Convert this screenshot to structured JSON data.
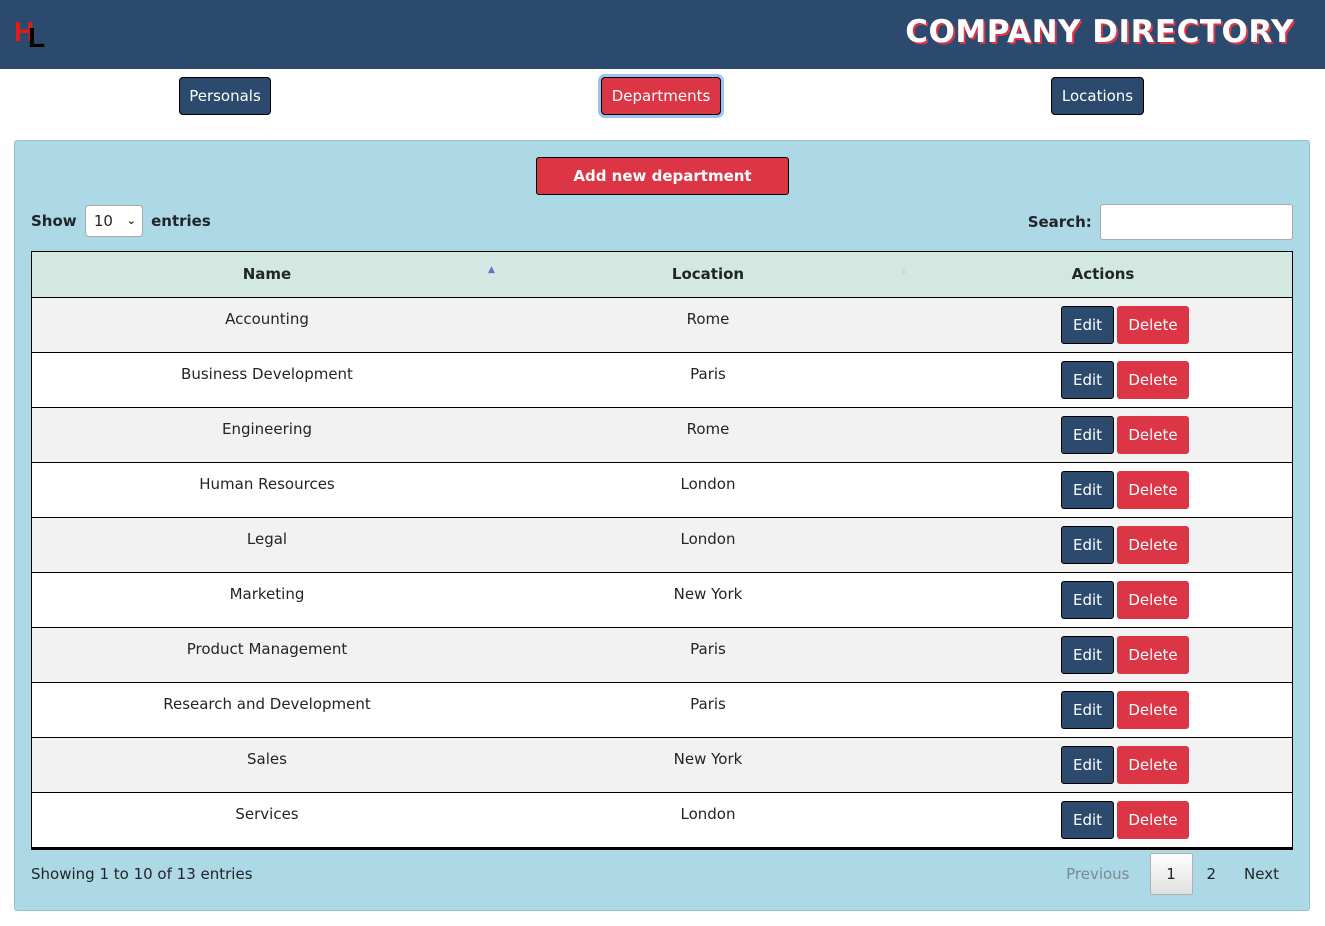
{
  "header": {
    "logo_letter_1": "H",
    "logo_letter_2": "L",
    "title": "COMPANY DIRECTORY",
    "colors": {
      "bar": "#2b4a6d",
      "accent": "#dc3545"
    }
  },
  "nav": {
    "personals": "Personals",
    "departments": "Departments",
    "locations": "Locations",
    "active": "Departments"
  },
  "panel": {
    "add_button": "Add new department",
    "show_label": "Show",
    "page_size": "10",
    "entries_label": "entries",
    "search_label": "Search:",
    "search_value": ""
  },
  "table": {
    "columns": [
      "Name",
      "Location",
      "Actions"
    ],
    "sort": {
      "column": "Name",
      "direction": "ascending"
    },
    "rows": [
      {
        "name": "Accounting",
        "location": "Rome"
      },
      {
        "name": "Business Development",
        "location": "Paris"
      },
      {
        "name": "Engineering",
        "location": "Rome"
      },
      {
        "name": "Human Resources",
        "location": "London"
      },
      {
        "name": "Legal",
        "location": "London"
      },
      {
        "name": "Marketing",
        "location": "New York"
      },
      {
        "name": "Product Management",
        "location": "Paris"
      },
      {
        "name": "Research and Development",
        "location": "Paris"
      },
      {
        "name": "Sales",
        "location": "New York"
      },
      {
        "name": "Services",
        "location": "London"
      }
    ],
    "edit_label": "Edit",
    "delete_label": "Delete"
  },
  "footer": {
    "info": "Showing 1 to 10 of 13 entries",
    "previous": "Previous",
    "pages": [
      "1",
      "2"
    ],
    "current_page": "1",
    "next": "Next"
  }
}
